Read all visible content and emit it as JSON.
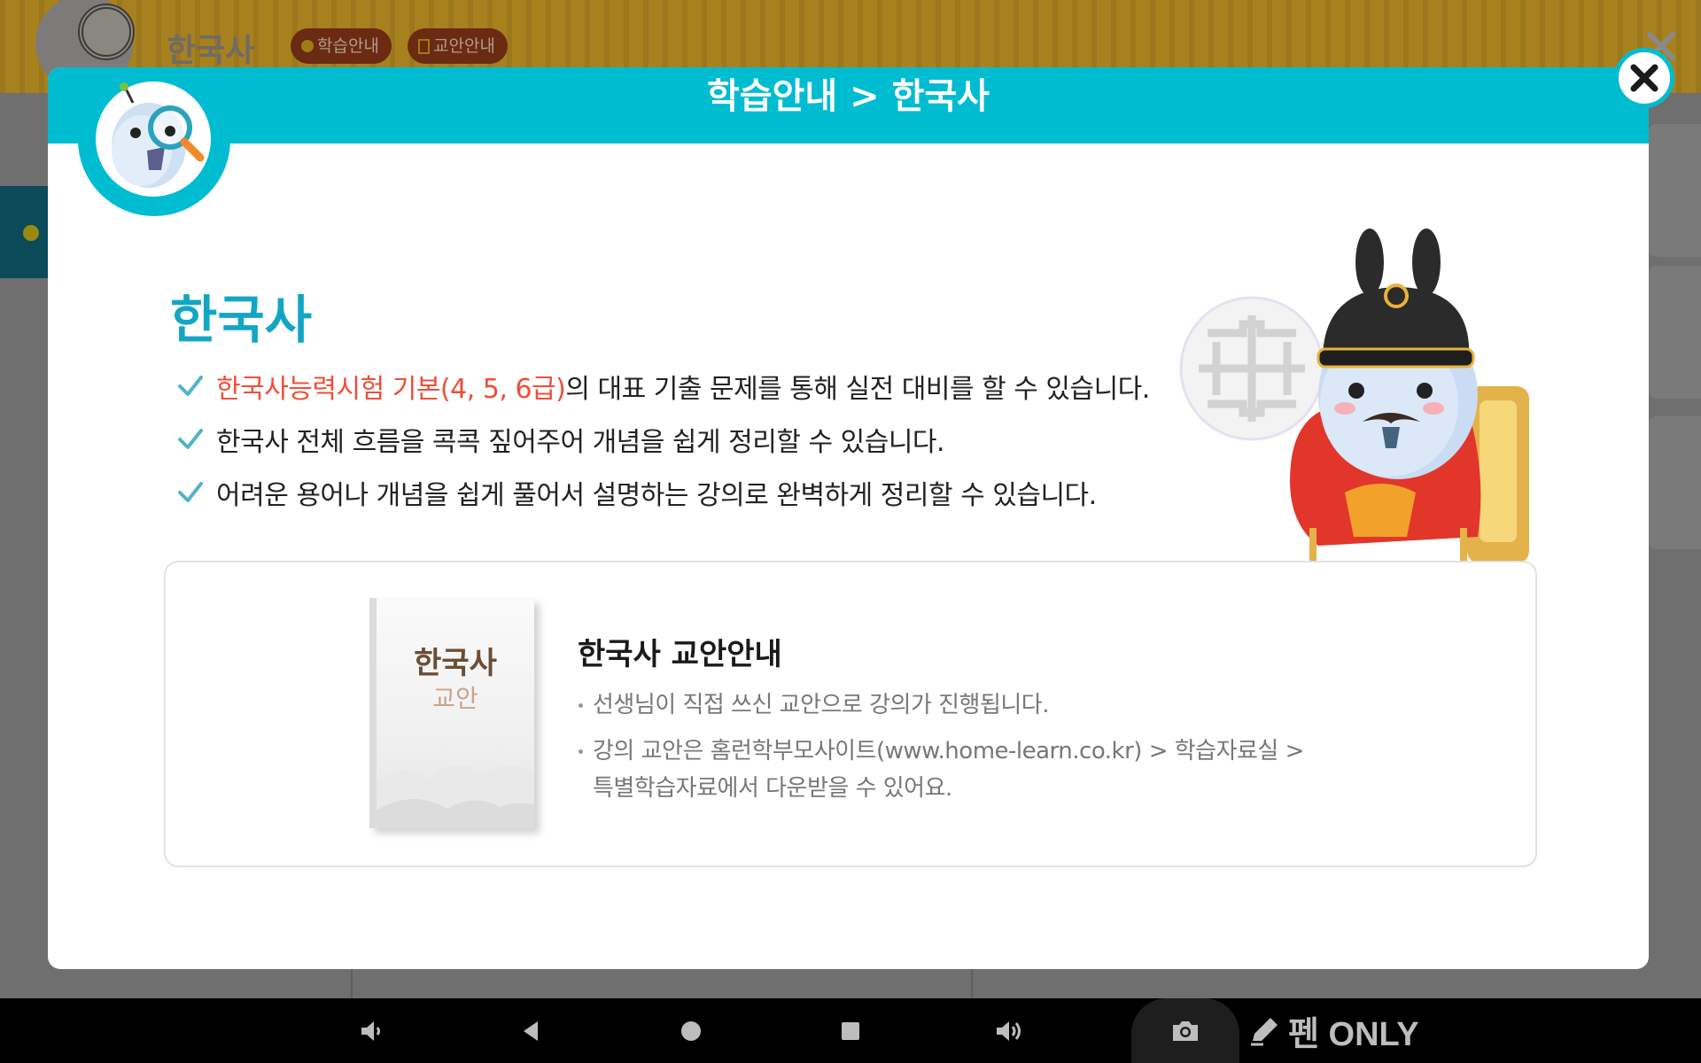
{
  "background_app": {
    "title": "한국사",
    "chips": [
      {
        "label": "학습안내",
        "icon": "dot-icon"
      },
      {
        "label": "교안안내",
        "icon": "document-icon"
      }
    ]
  },
  "modal": {
    "header_title": "학습안내 > 한국사",
    "subject_title": "한국사",
    "features": [
      {
        "highlight": "한국사능력시험 기본(4, 5, 6급)",
        "text": "의 대표 기출 문제를 통해 실전 대비를 할 수 있습니다."
      },
      {
        "highlight": "",
        "text": "한국사 전체 흐름을 콕콕 짚어주어 개념을 쉽게 정리할 수 있습니다."
      },
      {
        "highlight": "",
        "text": "어려운 용어나 개념을 쉽게 풀어서 설명하는 강의로 완벽하게 정리할 수 있습니다."
      }
    ],
    "guide": {
      "book_title": "한국사",
      "book_subtitle": "교안",
      "title": "한국사 교안안내",
      "bullets": [
        {
          "line1": "선생님이 직접 쓰신 교안으로 강의가 진행됩니다.",
          "line2": ""
        },
        {
          "line1": "강의 교안은 홈런학부모사이트(www.home-learn.co.kr) > 학습자료실 >",
          "line2": "특별학습자료에서 다운받을 수 있어요."
        }
      ]
    }
  },
  "navbar": {
    "pen_only_label": "펜 ONLY",
    "buttons": [
      "volume-down-icon",
      "back-icon",
      "home-icon",
      "recents-icon",
      "volume-up-icon",
      "camera-icon"
    ]
  },
  "colors": {
    "accent": "#00bcd0",
    "subject_title": "#13a6c4",
    "highlight": "#f04e37",
    "check": "#52b3c6"
  }
}
